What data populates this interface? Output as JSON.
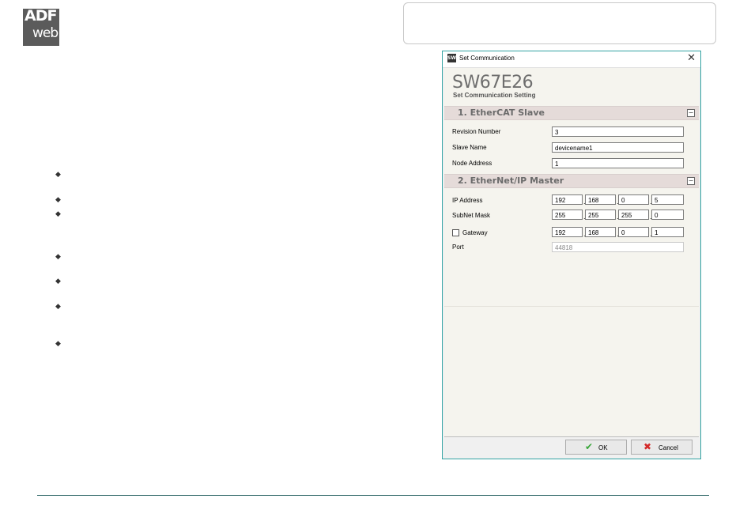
{
  "logo": {
    "line1": "ADF",
    "line2": "web"
  },
  "dialog": {
    "window_title": "Set Communication",
    "close_glyph": "✕",
    "app_icon_text": "SW",
    "heading": "SW67E26",
    "subheading": "Set Communication Setting",
    "collapse_glyph": "−",
    "section1": {
      "title": "1. EtherCAT Slave",
      "revision_label": "Revision Number",
      "revision_value": "3",
      "slave_name_label": "Slave Name",
      "slave_name_value": "devicename1",
      "node_address_label": "Node Address",
      "node_address_value": "1"
    },
    "section2": {
      "title": "2. EtherNet/IP Master",
      "ip_label": "IP Address",
      "ip": [
        "192",
        "168",
        "0",
        "5"
      ],
      "subnet_label": "SubNet Mask",
      "subnet": [
        "255",
        "255",
        "255",
        "0"
      ],
      "gateway_label": "Gateway",
      "gateway_checked": false,
      "gateway": [
        "192",
        "168",
        "0",
        "1"
      ],
      "port_label": "Port",
      "port_value": "44818"
    },
    "buttons": {
      "ok": "OK",
      "cancel": "Cancel"
    },
    "icons": {
      "ok": "check-icon",
      "cancel": "cross-icon"
    },
    "colors": {
      "border": "#33a3a3",
      "section_bg": "#e5dbd9",
      "ok_icon": "#3aa63a",
      "cancel_icon": "#d42a2a"
    }
  }
}
